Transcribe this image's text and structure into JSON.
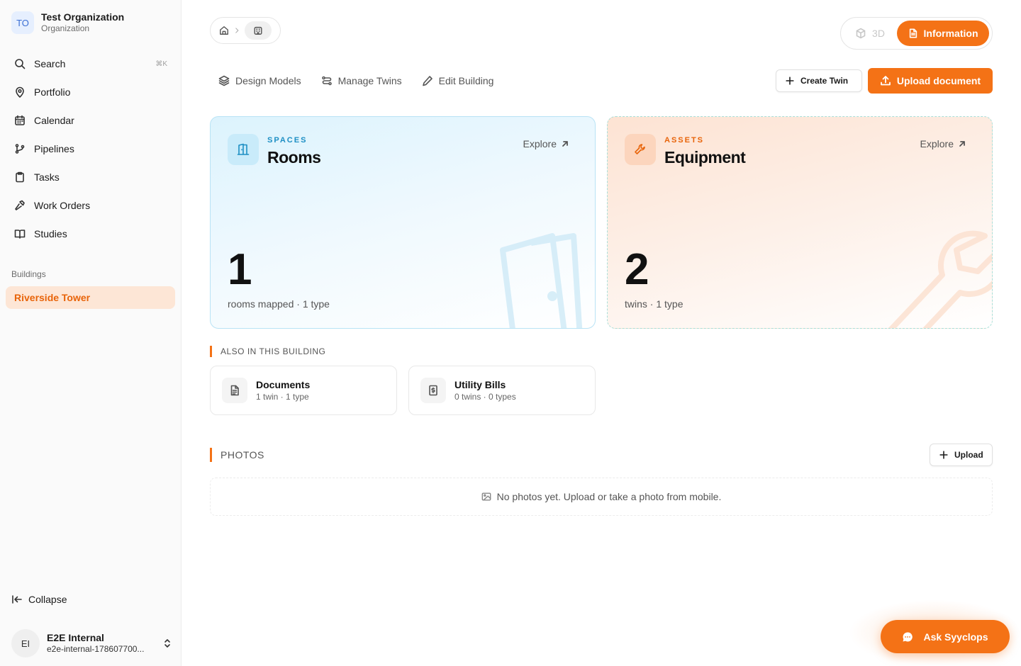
{
  "org": {
    "initials": "TO",
    "name": "Test Organization",
    "type": "Organization"
  },
  "nav": {
    "search": "Search",
    "search_shortcut": "⌘K",
    "portfolio": "Portfolio",
    "calendar": "Calendar",
    "pipelines": "Pipelines",
    "tasks": "Tasks",
    "work_orders": "Work Orders",
    "studies": "Studies"
  },
  "buildings": {
    "label": "Buildings",
    "active": "Riverside Tower"
  },
  "collapse_label": "Collapse",
  "user": {
    "initials": "EI",
    "name": "E2E Internal",
    "email": "e2e-internal-178607700..."
  },
  "view_toggle": {
    "three_d": "3D",
    "information": "Information"
  },
  "tabs": {
    "design_models": "Design Models",
    "manage_twins": "Manage Twins",
    "edit_building": "Edit Building"
  },
  "actions": {
    "create_twin": "Create Twin",
    "upload_document": "Upload document"
  },
  "cards": {
    "rooms": {
      "kicker": "SPACES",
      "title": "Rooms",
      "explore": "Explore",
      "count": "1",
      "sub": "rooms mapped · 1 type",
      "color": "#1d8fc4"
    },
    "equipment": {
      "kicker": "ASSETS",
      "title": "Equipment",
      "explore": "Explore",
      "count": "2",
      "sub": "twins · 1 type",
      "color": "#e8640a"
    }
  },
  "also": {
    "label": "ALSO IN THIS BUILDING",
    "documents": {
      "title": "Documents",
      "sub": "1 twin · 1 type"
    },
    "utility_bills": {
      "title": "Utility Bills",
      "sub": "0 twins · 0 types"
    }
  },
  "photos": {
    "label": "PHOTOS",
    "upload": "Upload",
    "empty": "No photos yet. Upload or take a photo from mobile."
  },
  "assistant": {
    "label": "Ask Syyclops"
  },
  "colors": {
    "accent": "#f47216",
    "active_bg": "#fde6d6"
  }
}
